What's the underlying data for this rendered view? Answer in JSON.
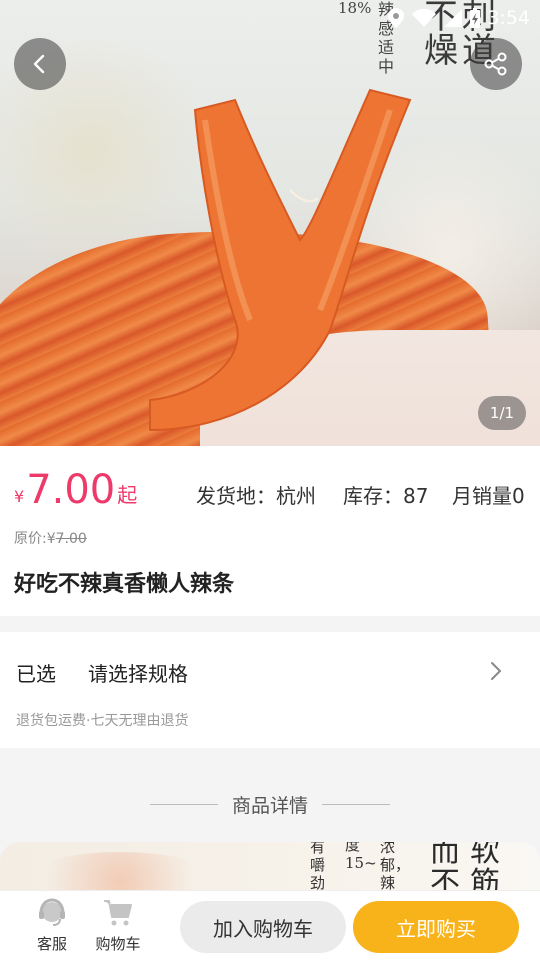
{
  "status_bar": {
    "battery_percent": "18%",
    "time": "3:54",
    "icons": [
      "location-icon",
      "wifi-icon",
      "signal-icon",
      "battery-charging-icon"
    ]
  },
  "hero": {
    "counter": "1/1",
    "overlay_text": {
      "vertical_phrase": "辣感适中",
      "big_text": "不刺燥道"
    }
  },
  "header": {
    "back_icon": "chevron-left-icon",
    "share_icon": "share-icon"
  },
  "product": {
    "price_symbol": "¥",
    "price": "7.00",
    "price_suffix": "起",
    "ship_from_label": "发货地：",
    "ship_from": "杭州",
    "stock_label": "库存：",
    "stock": "87",
    "monthly_sales_label": "月销量",
    "monthly_sales": "0",
    "original_price_label": "原价:¥",
    "original_price": "7.00",
    "title": "好吃不辣真香懒人辣条"
  },
  "spec": {
    "selected_label": "已选",
    "selected_value": "请选择规格",
    "policy": "退货包运费·七天无理由退货"
  },
  "details": {
    "header": "商品详情",
    "image_text": {
      "col1": "有嚼劲",
      "col2": "度15~",
      "col3": "浓郁，辣",
      "col4": "而不",
      "col5": "软筋"
    }
  },
  "bottom_bar": {
    "service_label": "客服",
    "cart_label": "购物车",
    "add_to_cart": "加入购物车",
    "buy_now": "立即购买"
  },
  "colors": {
    "price": "#ee3a6b",
    "buy_button": "#f8b31a",
    "cart_button": "#ebebeb"
  }
}
